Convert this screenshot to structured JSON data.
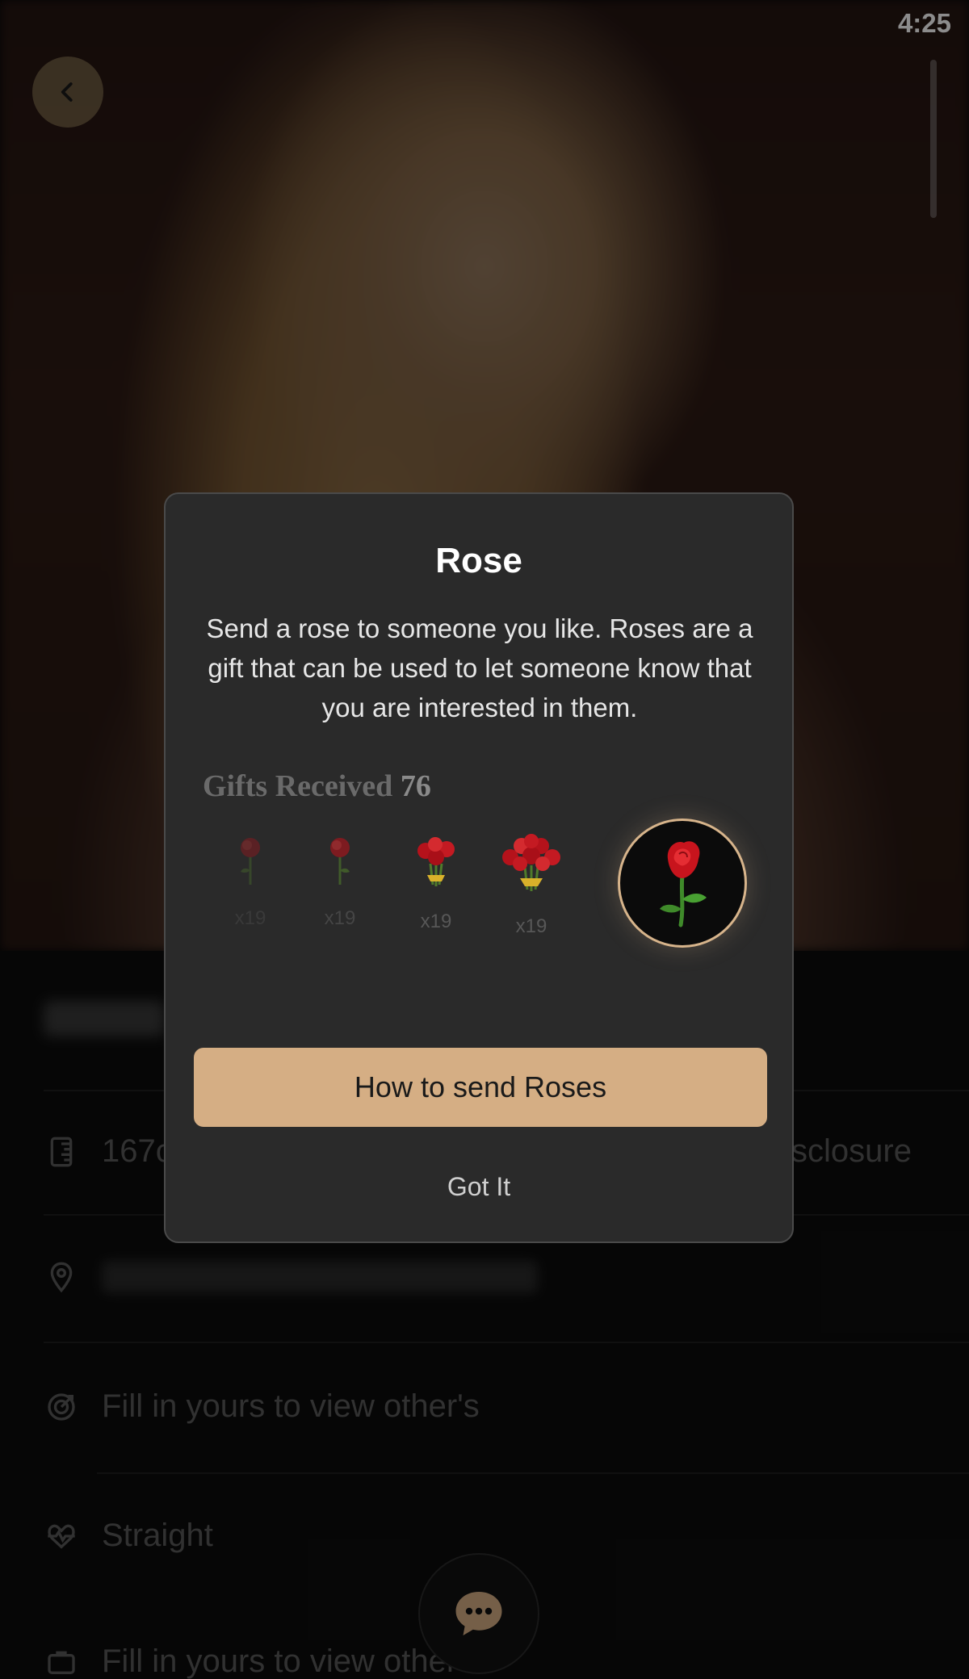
{
  "status_bar": {
    "time": "4:25"
  },
  "profile": {
    "info_rows": {
      "height": "167c",
      "disclosure_suffix": "sclosure",
      "row3": "Fill in yours to view other's",
      "row4": "Straight",
      "row5": "Fill in yours to view other's"
    }
  },
  "modal": {
    "title": "Rose",
    "description": "Send a rose to someone you like. Roses are a gift that can be used to let someone know that you are interested in them.",
    "gifts_label": "Gifts Received",
    "gifts_count": "76",
    "gifts": [
      {
        "count": "x19",
        "icon": "single-rose-icon"
      },
      {
        "count": "x19",
        "icon": "single-rose-icon"
      },
      {
        "count": "x19",
        "icon": "rose-bouquet-small-icon"
      },
      {
        "count": "x19",
        "icon": "rose-bouquet-large-icon"
      }
    ],
    "selected_gift_icon": "rose-icon",
    "primary_button": "How to send Roses",
    "secondary_button": "Got It",
    "accent_color": "#d5ae84"
  }
}
